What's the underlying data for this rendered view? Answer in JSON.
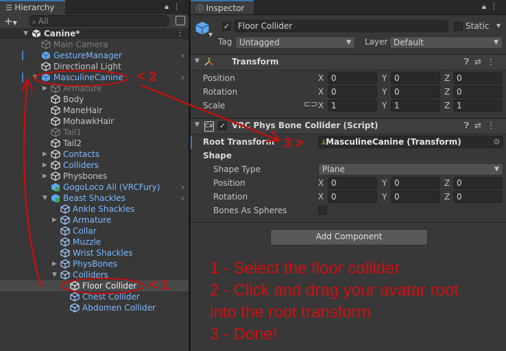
{
  "hierarchy": {
    "tab_label": "Hierarchy",
    "search_placeholder": "All",
    "scene_name": "Canine*",
    "items": [
      {
        "label": "Main Camera",
        "disabled": true
      },
      {
        "label": "GestureManager"
      },
      {
        "label": "Directional Light"
      },
      {
        "label": "MasculineCanine"
      },
      {
        "label": "Armature",
        "disabled": true
      },
      {
        "label": "Body"
      },
      {
        "label": "ManeHair"
      },
      {
        "label": "MohawkHair"
      },
      {
        "label": "Tail1",
        "disabled": true
      },
      {
        "label": "Tail2"
      },
      {
        "label": "Contacts"
      },
      {
        "label": "Colliders"
      },
      {
        "label": "Physbones"
      },
      {
        "label": "GogoLoco All (VRCFury)"
      },
      {
        "label": "Beast Shackles"
      },
      {
        "label": "Ankle Shackles"
      },
      {
        "label": "Armature"
      },
      {
        "label": "Collar"
      },
      {
        "label": "Muzzle"
      },
      {
        "label": "Wrist Shackles"
      },
      {
        "label": "PhysBones"
      },
      {
        "label": "Colliders"
      },
      {
        "label": "Floor Collider",
        "selected": true
      },
      {
        "label": "Chest Collider"
      },
      {
        "label": "Abdomen Collider"
      }
    ]
  },
  "inspector": {
    "tab_label": "Inspector",
    "object_name": "Floor Collider",
    "static_label": "Static",
    "tag_label": "Tag",
    "tag_value": "Untagged",
    "layer_label": "Layer",
    "layer_value": "Default",
    "transform": {
      "title": "Transform",
      "position_label": "Position",
      "rotation_label": "Rotation",
      "scale_label": "Scale",
      "position": [
        "0",
        "0",
        "0"
      ],
      "rotation": [
        "0",
        "0",
        "0"
      ],
      "scale": [
        "1",
        "1",
        "1"
      ]
    },
    "axes": [
      "X",
      "Y",
      "Z"
    ],
    "collider": {
      "title": "VRC Phys Bone Collider (Script)",
      "root_transform_label": "Root Transform",
      "root_transform_value": "MasculineCanine (Transform)",
      "shape_label": "Shape",
      "shape_type_label": "Shape Type",
      "shape_type_value": "Plane",
      "position_label": "Position",
      "rotation_label": "Rotation",
      "position": [
        "0",
        "0",
        "0"
      ],
      "rotation": [
        "0",
        "0",
        "0"
      ],
      "bones_as_spheres_label": "Bones As Spheres"
    },
    "add_component_label": "Add Component"
  },
  "annotations": {
    "tag1": "< 1",
    "tag2": "< 2",
    "tag3": "3 >",
    "steps": [
      "1 - Select the floor collider",
      "2 - Click and drag your avatar root",
      "into the root transform",
      "3 - Done!"
    ]
  },
  "colors": {
    "annotation_red": "#d01010",
    "selection": "#4a4a4a",
    "prefab_blue": "#7cb8ff",
    "accent": "#3a72b0"
  }
}
